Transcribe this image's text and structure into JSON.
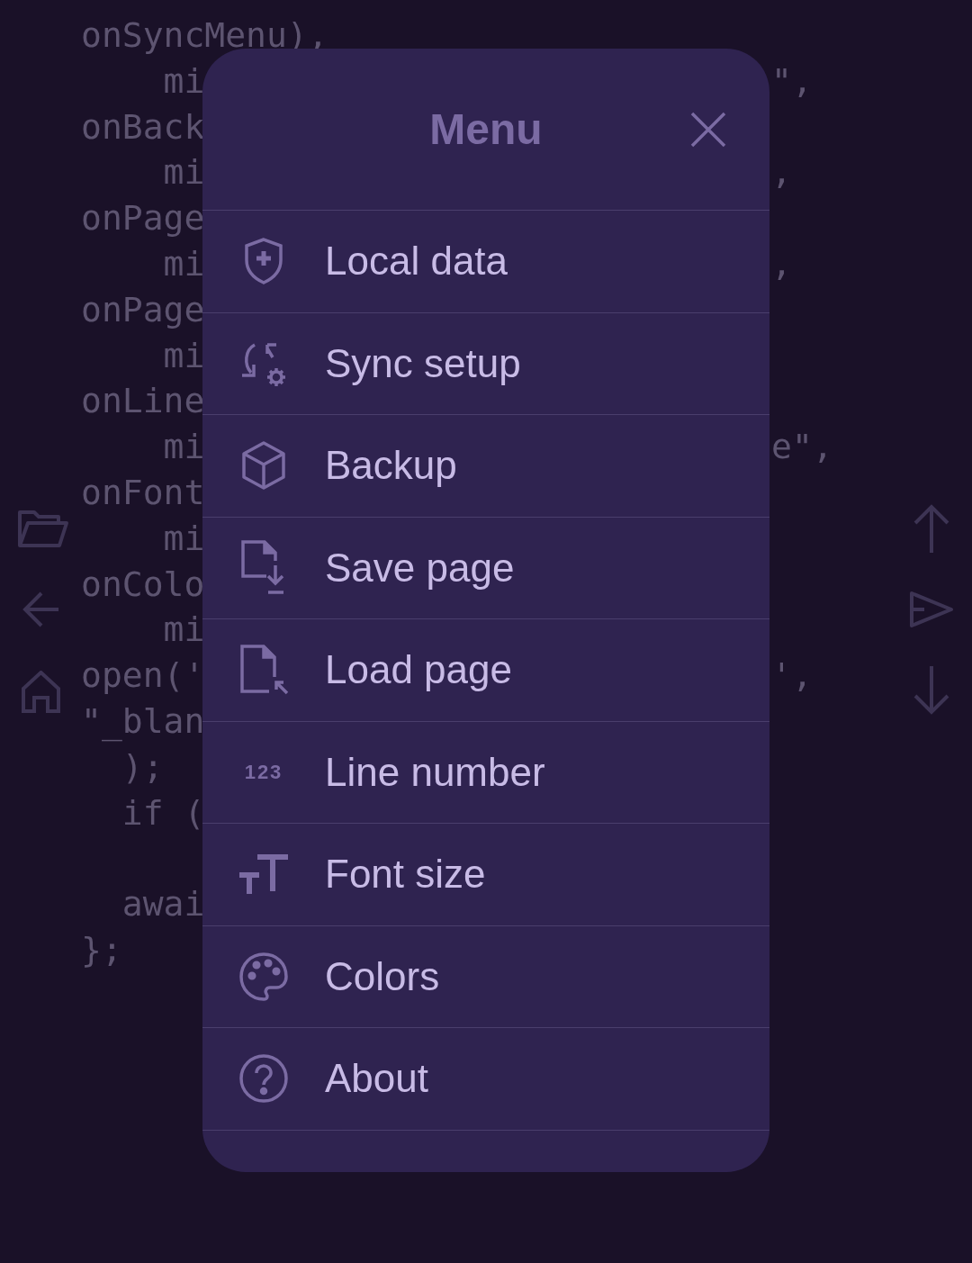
{
  "code_lines": [
    {
      "left": "onSyncMenu),"
    },
    {
      "left": "    mi",
      "right": "\","
    },
    {
      "left": "onBack"
    },
    {
      "left": "    mi",
      "right": ","
    },
    {
      "left": "onPage"
    },
    {
      "left": "    mi",
      "right": ","
    },
    {
      "left": "onPage"
    },
    {
      "left": "    mi"
    },
    {
      "left": "onLine"
    },
    {
      "left": "    mi",
      "right": "e\","
    },
    {
      "left": "onFont"
    },
    {
      "left": "    mi"
    },
    {
      "left": "onColo"
    },
    {
      "left": "    mi"
    },
    {
      "left": "open('",
      "right": "',"
    },
    {
      "left": "\"_blan"
    },
    {
      "left": "  );"
    },
    {
      "left": "  if ("
    },
    {
      "left": "  awai",
      "gap_before": true
    },
    {
      "left": "};"
    }
  ],
  "menu": {
    "title": "Menu",
    "items": [
      {
        "label": "Local data"
      },
      {
        "label": "Sync setup"
      },
      {
        "label": "Backup"
      },
      {
        "label": "Save page"
      },
      {
        "label": "Load page"
      },
      {
        "label": "Line number",
        "icon_text": "123"
      },
      {
        "label": "Font size"
      },
      {
        "label": "Colors"
      },
      {
        "label": "About"
      }
    ]
  }
}
